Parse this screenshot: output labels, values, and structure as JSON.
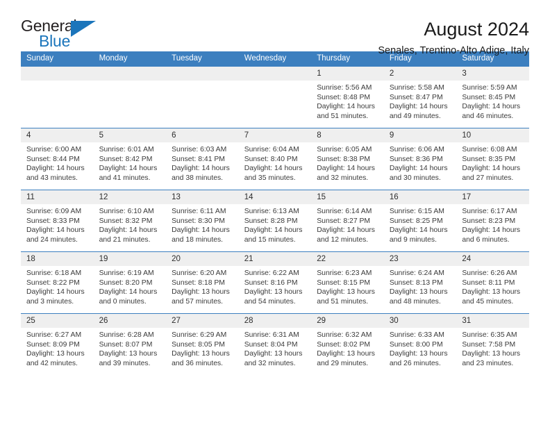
{
  "brand": {
    "name_part1": "General",
    "name_part2": "Blue",
    "accent_color": "#1b75bb"
  },
  "header": {
    "title": "August 2024",
    "subtitle": "Senales, Trentino-Alto Adige, Italy"
  },
  "theme": {
    "header_bg": "#3c7fbf",
    "daynum_bg": "#efefef",
    "text_color": "#3a3a3a"
  },
  "weekday_headers": [
    "Sunday",
    "Monday",
    "Tuesday",
    "Wednesday",
    "Thursday",
    "Friday",
    "Saturday"
  ],
  "weeks": [
    [
      {
        "day": "",
        "blank": true,
        "sunrise": "",
        "sunset": "",
        "daylight_line1": "",
        "daylight_line2": ""
      },
      {
        "day": "",
        "blank": true,
        "sunrise": "",
        "sunset": "",
        "daylight_line1": "",
        "daylight_line2": ""
      },
      {
        "day": "",
        "blank": true,
        "sunrise": "",
        "sunset": "",
        "daylight_line1": "",
        "daylight_line2": ""
      },
      {
        "day": "",
        "blank": true,
        "sunrise": "",
        "sunset": "",
        "daylight_line1": "",
        "daylight_line2": ""
      },
      {
        "day": "1",
        "sunrise": "Sunrise: 5:56 AM",
        "sunset": "Sunset: 8:48 PM",
        "daylight_line1": "Daylight: 14 hours",
        "daylight_line2": "and 51 minutes."
      },
      {
        "day": "2",
        "sunrise": "Sunrise: 5:58 AM",
        "sunset": "Sunset: 8:47 PM",
        "daylight_line1": "Daylight: 14 hours",
        "daylight_line2": "and 49 minutes."
      },
      {
        "day": "3",
        "sunrise": "Sunrise: 5:59 AM",
        "sunset": "Sunset: 8:45 PM",
        "daylight_line1": "Daylight: 14 hours",
        "daylight_line2": "and 46 minutes."
      }
    ],
    [
      {
        "day": "4",
        "sunrise": "Sunrise: 6:00 AM",
        "sunset": "Sunset: 8:44 PM",
        "daylight_line1": "Daylight: 14 hours",
        "daylight_line2": "and 43 minutes."
      },
      {
        "day": "5",
        "sunrise": "Sunrise: 6:01 AM",
        "sunset": "Sunset: 8:42 PM",
        "daylight_line1": "Daylight: 14 hours",
        "daylight_line2": "and 41 minutes."
      },
      {
        "day": "6",
        "sunrise": "Sunrise: 6:03 AM",
        "sunset": "Sunset: 8:41 PM",
        "daylight_line1": "Daylight: 14 hours",
        "daylight_line2": "and 38 minutes."
      },
      {
        "day": "7",
        "sunrise": "Sunrise: 6:04 AM",
        "sunset": "Sunset: 8:40 PM",
        "daylight_line1": "Daylight: 14 hours",
        "daylight_line2": "and 35 minutes."
      },
      {
        "day": "8",
        "sunrise": "Sunrise: 6:05 AM",
        "sunset": "Sunset: 8:38 PM",
        "daylight_line1": "Daylight: 14 hours",
        "daylight_line2": "and 32 minutes."
      },
      {
        "day": "9",
        "sunrise": "Sunrise: 6:06 AM",
        "sunset": "Sunset: 8:36 PM",
        "daylight_line1": "Daylight: 14 hours",
        "daylight_line2": "and 30 minutes."
      },
      {
        "day": "10",
        "sunrise": "Sunrise: 6:08 AM",
        "sunset": "Sunset: 8:35 PM",
        "daylight_line1": "Daylight: 14 hours",
        "daylight_line2": "and 27 minutes."
      }
    ],
    [
      {
        "day": "11",
        "sunrise": "Sunrise: 6:09 AM",
        "sunset": "Sunset: 8:33 PM",
        "daylight_line1": "Daylight: 14 hours",
        "daylight_line2": "and 24 minutes."
      },
      {
        "day": "12",
        "sunrise": "Sunrise: 6:10 AM",
        "sunset": "Sunset: 8:32 PM",
        "daylight_line1": "Daylight: 14 hours",
        "daylight_line2": "and 21 minutes."
      },
      {
        "day": "13",
        "sunrise": "Sunrise: 6:11 AM",
        "sunset": "Sunset: 8:30 PM",
        "daylight_line1": "Daylight: 14 hours",
        "daylight_line2": "and 18 minutes."
      },
      {
        "day": "14",
        "sunrise": "Sunrise: 6:13 AM",
        "sunset": "Sunset: 8:28 PM",
        "daylight_line1": "Daylight: 14 hours",
        "daylight_line2": "and 15 minutes."
      },
      {
        "day": "15",
        "sunrise": "Sunrise: 6:14 AM",
        "sunset": "Sunset: 8:27 PM",
        "daylight_line1": "Daylight: 14 hours",
        "daylight_line2": "and 12 minutes."
      },
      {
        "day": "16",
        "sunrise": "Sunrise: 6:15 AM",
        "sunset": "Sunset: 8:25 PM",
        "daylight_line1": "Daylight: 14 hours",
        "daylight_line2": "and 9 minutes."
      },
      {
        "day": "17",
        "sunrise": "Sunrise: 6:17 AM",
        "sunset": "Sunset: 8:23 PM",
        "daylight_line1": "Daylight: 14 hours",
        "daylight_line2": "and 6 minutes."
      }
    ],
    [
      {
        "day": "18",
        "sunrise": "Sunrise: 6:18 AM",
        "sunset": "Sunset: 8:22 PM",
        "daylight_line1": "Daylight: 14 hours",
        "daylight_line2": "and 3 minutes."
      },
      {
        "day": "19",
        "sunrise": "Sunrise: 6:19 AM",
        "sunset": "Sunset: 8:20 PM",
        "daylight_line1": "Daylight: 14 hours",
        "daylight_line2": "and 0 minutes."
      },
      {
        "day": "20",
        "sunrise": "Sunrise: 6:20 AM",
        "sunset": "Sunset: 8:18 PM",
        "daylight_line1": "Daylight: 13 hours",
        "daylight_line2": "and 57 minutes."
      },
      {
        "day": "21",
        "sunrise": "Sunrise: 6:22 AM",
        "sunset": "Sunset: 8:16 PM",
        "daylight_line1": "Daylight: 13 hours",
        "daylight_line2": "and 54 minutes."
      },
      {
        "day": "22",
        "sunrise": "Sunrise: 6:23 AM",
        "sunset": "Sunset: 8:15 PM",
        "daylight_line1": "Daylight: 13 hours",
        "daylight_line2": "and 51 minutes."
      },
      {
        "day": "23",
        "sunrise": "Sunrise: 6:24 AM",
        "sunset": "Sunset: 8:13 PM",
        "daylight_line1": "Daylight: 13 hours",
        "daylight_line2": "and 48 minutes."
      },
      {
        "day": "24",
        "sunrise": "Sunrise: 6:26 AM",
        "sunset": "Sunset: 8:11 PM",
        "daylight_line1": "Daylight: 13 hours",
        "daylight_line2": "and 45 minutes."
      }
    ],
    [
      {
        "day": "25",
        "sunrise": "Sunrise: 6:27 AM",
        "sunset": "Sunset: 8:09 PM",
        "daylight_line1": "Daylight: 13 hours",
        "daylight_line2": "and 42 minutes."
      },
      {
        "day": "26",
        "sunrise": "Sunrise: 6:28 AM",
        "sunset": "Sunset: 8:07 PM",
        "daylight_line1": "Daylight: 13 hours",
        "daylight_line2": "and 39 minutes."
      },
      {
        "day": "27",
        "sunrise": "Sunrise: 6:29 AM",
        "sunset": "Sunset: 8:05 PM",
        "daylight_line1": "Daylight: 13 hours",
        "daylight_line2": "and 36 minutes."
      },
      {
        "day": "28",
        "sunrise": "Sunrise: 6:31 AM",
        "sunset": "Sunset: 8:04 PM",
        "daylight_line1": "Daylight: 13 hours",
        "daylight_line2": "and 32 minutes."
      },
      {
        "day": "29",
        "sunrise": "Sunrise: 6:32 AM",
        "sunset": "Sunset: 8:02 PM",
        "daylight_line1": "Daylight: 13 hours",
        "daylight_line2": "and 29 minutes."
      },
      {
        "day": "30",
        "sunrise": "Sunrise: 6:33 AM",
        "sunset": "Sunset: 8:00 PM",
        "daylight_line1": "Daylight: 13 hours",
        "daylight_line2": "and 26 minutes."
      },
      {
        "day": "31",
        "sunrise": "Sunrise: 6:35 AM",
        "sunset": "Sunset: 7:58 PM",
        "daylight_line1": "Daylight: 13 hours",
        "daylight_line2": "and 23 minutes."
      }
    ]
  ]
}
